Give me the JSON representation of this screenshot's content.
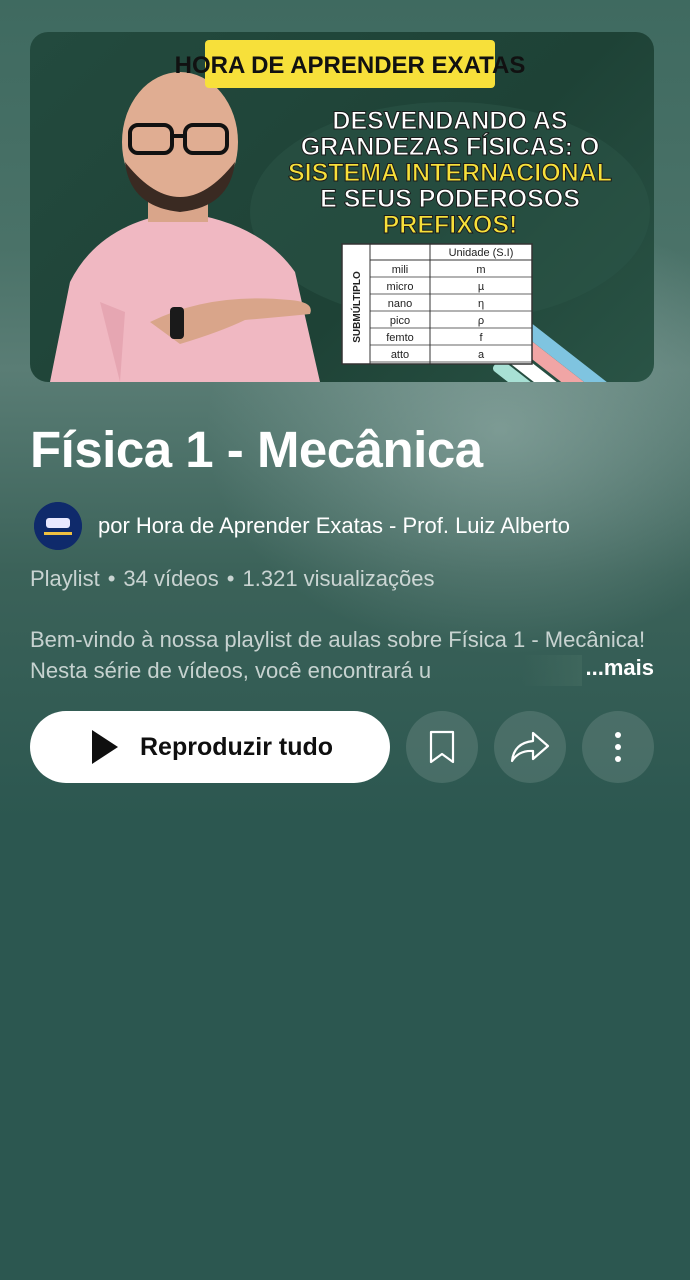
{
  "thumbnail": {
    "banner": "HORA DE APRENDER EXATAS",
    "headline_line1": "DESVENDANDO AS",
    "headline_line2": "GRANDEZAS FÍSICAS: O",
    "headline_line3": "SISTEMA INTERNACIONAL",
    "headline_line4": "E SEUS PODEROSOS",
    "headline_line5": "PREFIXOS!",
    "table_header": "Unidade (S.I)",
    "table_side_label": "SUBMÚLTIPLO",
    "table_rows": [
      {
        "prefix": "mili",
        "symbol": "m"
      },
      {
        "prefix": "micro",
        "symbol": "µ"
      },
      {
        "prefix": "nano",
        "symbol": "η"
      },
      {
        "prefix": "pico",
        "symbol": "ρ"
      },
      {
        "prefix": "femto",
        "symbol": "f"
      },
      {
        "prefix": "atto",
        "symbol": "a"
      }
    ],
    "colors": {
      "banner": "#f7e03a",
      "accent_text": "#f7e03a",
      "board": "#234a3e"
    }
  },
  "playlist": {
    "title": "Física 1 - Mecânica",
    "channel": "por Hora de Aprender Exatas - Prof. Luiz Alberto",
    "type": "Playlist",
    "video_count": "34 vídeos",
    "views": "1.321 visualizações",
    "separator": "•",
    "description": "Bem-vindo à nossa playlist de aulas sobre Física 1 - Mecânica! Nesta série de vídeos, você encontrará u",
    "more_label": "...mais"
  },
  "actions": {
    "play_all_label": "Reproduzir tudo",
    "save_icon": "bookmark-icon",
    "share_icon": "share-icon",
    "more_icon": "more-vert-icon"
  }
}
